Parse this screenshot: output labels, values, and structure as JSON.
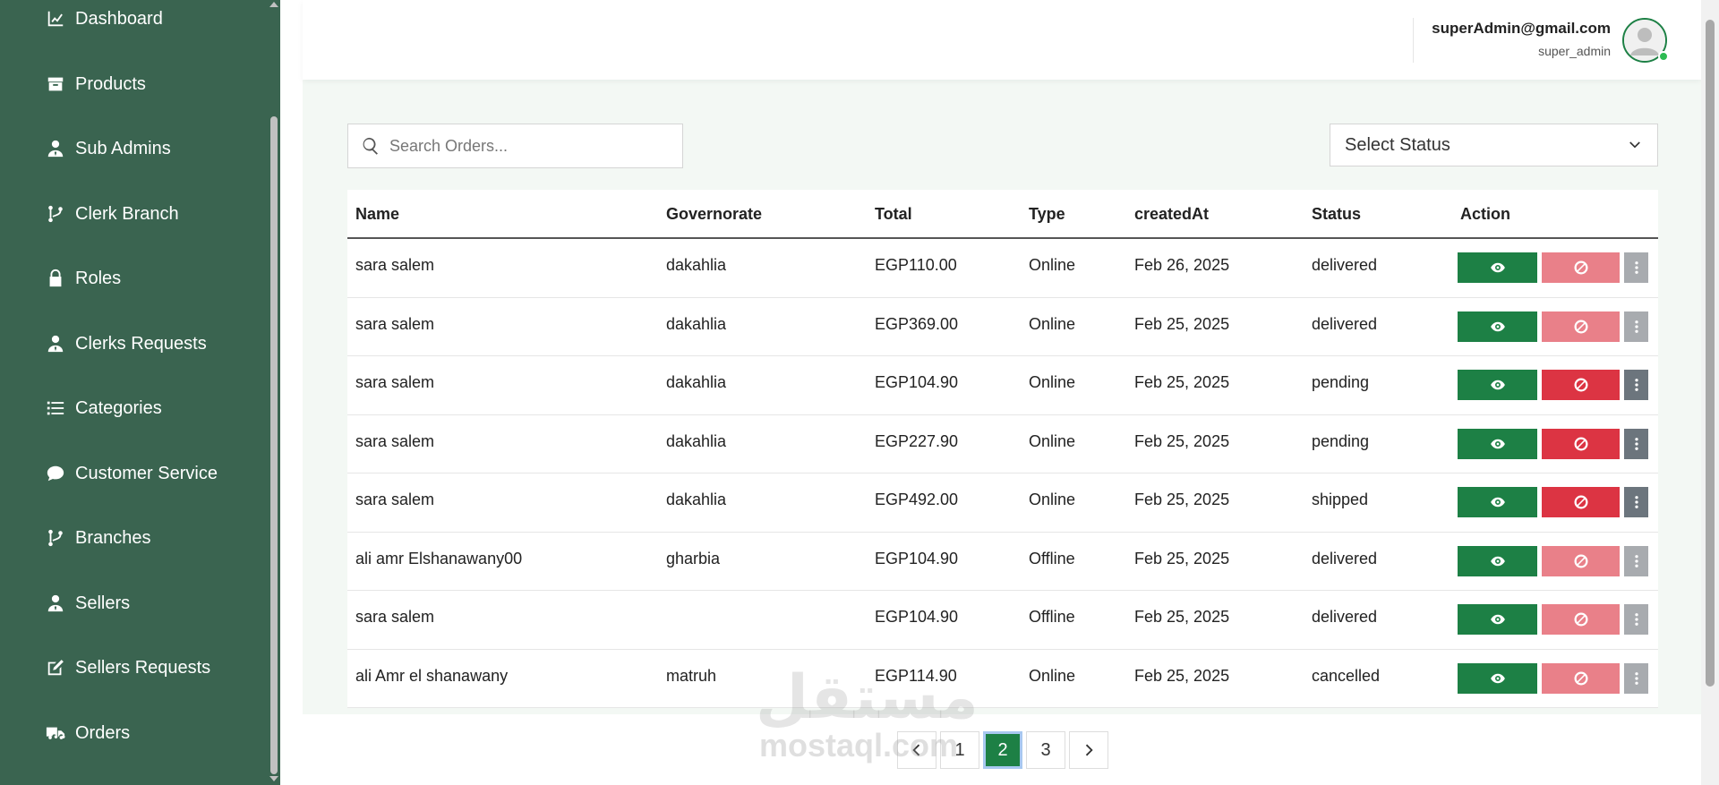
{
  "sidebar": {
    "items": [
      {
        "label": "Dashboard",
        "icon": "chart-line-icon"
      },
      {
        "label": "Products",
        "icon": "box-icon"
      },
      {
        "label": "Sub Admins",
        "icon": "user-tie-icon"
      },
      {
        "label": "Clerk Branch",
        "icon": "branch-icon"
      },
      {
        "label": "Roles",
        "icon": "lock-icon"
      },
      {
        "label": "Clerks Requests",
        "icon": "user-tie-icon"
      },
      {
        "label": "Categories",
        "icon": "list-icon"
      },
      {
        "label": "Customer Service",
        "icon": "comment-icon"
      },
      {
        "label": "Branches",
        "icon": "branch-icon"
      },
      {
        "label": "Sellers",
        "icon": "user-tie-icon"
      },
      {
        "label": "Sellers Requests",
        "icon": "edit-icon"
      },
      {
        "label": "Orders",
        "icon": "truck-icon"
      }
    ]
  },
  "header": {
    "email": "superAdmin@gmail.com",
    "role": "super_admin"
  },
  "search": {
    "placeholder": "Search Orders..."
  },
  "status_select": {
    "selected": "Select Status"
  },
  "table": {
    "columns": [
      "Name",
      "Governorate",
      "Total",
      "Type",
      "createdAt",
      "Status",
      "Action"
    ],
    "rows": [
      {
        "name": "sara salem",
        "governorate": "dakahlia",
        "total": "EGP110.00",
        "type": "Online",
        "created": "Feb 26, 2025",
        "status": "delivered"
      },
      {
        "name": "sara salem",
        "governorate": "dakahlia",
        "total": "EGP369.00",
        "type": "Online",
        "created": "Feb 25, 2025",
        "status": "delivered"
      },
      {
        "name": "sara salem",
        "governorate": "dakahlia",
        "total": "EGP104.90",
        "type": "Online",
        "created": "Feb 25, 2025",
        "status": "pending"
      },
      {
        "name": "sara salem",
        "governorate": "dakahlia",
        "total": "EGP227.90",
        "type": "Online",
        "created": "Feb 25, 2025",
        "status": "pending"
      },
      {
        "name": "sara salem",
        "governorate": "dakahlia",
        "total": "EGP492.00",
        "type": "Online",
        "created": "Feb 25, 2025",
        "status": "shipped"
      },
      {
        "name": "ali amr Elshanawany00",
        "governorate": "gharbia",
        "total": "EGP104.90",
        "type": "Offline",
        "created": "Feb 25, 2025",
        "status": "delivered"
      },
      {
        "name": "sara salem",
        "governorate": "",
        "total": "EGP104.90",
        "type": "Offline",
        "created": "Feb 25, 2025",
        "status": "delivered"
      },
      {
        "name": "ali Amr el shanawany",
        "governorate": "matruh",
        "total": "EGP114.90",
        "type": "Online",
        "created": "Feb 25, 2025",
        "status": "cancelled"
      }
    ]
  },
  "pagination": {
    "pages": [
      "1",
      "2",
      "3"
    ],
    "current": "2"
  },
  "watermark": {
    "arabic": "مستقل",
    "latin": "mostaql.com"
  },
  "colors": {
    "sidebar_bg": "#3a6450",
    "primary_green": "#1d8045",
    "danger_red": "#dc3443",
    "danger_red_disabled": "#e98089",
    "main_bg": "#f3f8f4"
  }
}
